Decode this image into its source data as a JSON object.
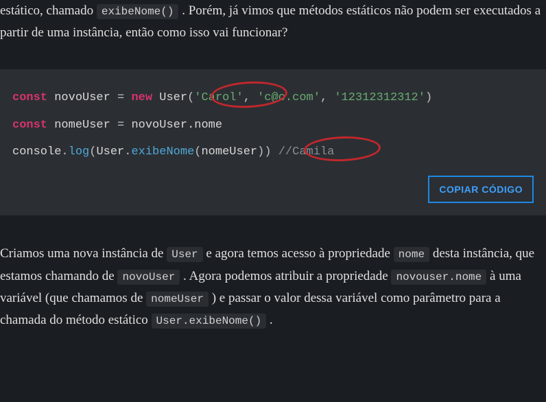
{
  "para1": {
    "t1": "estático, chamado ",
    "code1": "exibeNome()",
    "t2": " . Porém, já vimos que métodos estáticos não podem ser executados a partir de uma instância, então como isso vai funcionar?"
  },
  "code": {
    "line1": {
      "kw_const": "const",
      "ident_novoUser": "novoUser",
      "eq": "=",
      "kw_new": "new",
      "cls_User": "User",
      "lparen": "(",
      "str_carol": "'Carol'",
      "comma1": ",",
      "str_email": "'c@c.com'",
      "comma2": ",",
      "str_num": "'12312312312'",
      "rparen": ")"
    },
    "line2": {
      "kw_const": "const",
      "ident_nomeUser": "nomeUser",
      "eq": "=",
      "expr": "novoUser.nome"
    },
    "line3": {
      "obj": "console",
      "dot": ".",
      "method_log": "log",
      "lparen": "(",
      "cls_User": "User",
      "dot2": ".",
      "method_exibe": "exibeNome",
      "lparen2": "(",
      "arg": "nomeUser",
      "rparen2": ")",
      "rparen": ")",
      "comment": " //Camila"
    },
    "copy_label": "COPIAR CÓDIGO"
  },
  "para2": {
    "t1": "Criamos uma nova instância de ",
    "code1": "User",
    "t2": " e agora temos acesso à propriedade ",
    "code2": "nome",
    "t3": " desta instância, que estamos chamando de ",
    "code3": "novoUser",
    "t4": " . Agora podemos atribuir a propriedade ",
    "code4": "novouser.nome",
    "t5": " à uma variável (que chamamos de ",
    "code5": "nomeUser",
    "t6": " ) e passar o valor dessa variável como parâmetro para a chamada do método estático ",
    "code6": "User.exibeNome()",
    "t7": " ."
  }
}
